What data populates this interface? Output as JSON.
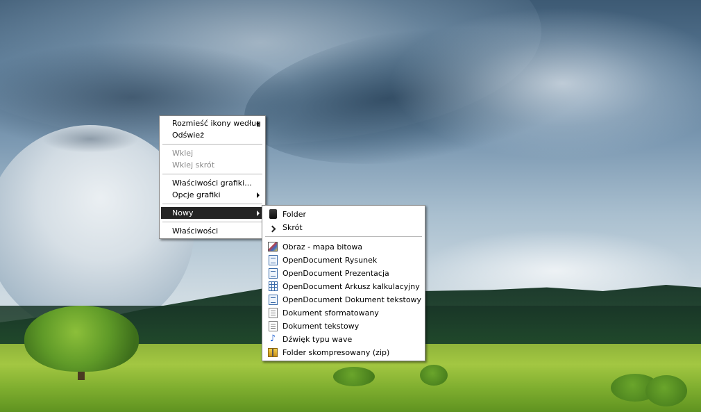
{
  "context_menu": {
    "items": [
      {
        "label": "Rozmieść ikony według",
        "has_submenu": true,
        "disabled": false
      },
      {
        "label": "Odśwież",
        "has_submenu": false,
        "disabled": false
      },
      {
        "label": "Wklej",
        "has_submenu": false,
        "disabled": true
      },
      {
        "label": "Wklej skrót",
        "has_submenu": false,
        "disabled": true
      },
      {
        "label": "Właściwości grafiki...",
        "has_submenu": false,
        "disabled": false
      },
      {
        "label": "Opcje grafiki",
        "has_submenu": true,
        "disabled": false
      },
      {
        "label": "Nowy",
        "has_submenu": true,
        "disabled": false,
        "highlighted": true
      },
      {
        "label": "Właściwości",
        "has_submenu": false,
        "disabled": false
      }
    ]
  },
  "new_submenu": {
    "items": [
      {
        "label": "Folder",
        "icon": "folder-icon"
      },
      {
        "label": "Skrót",
        "icon": "shortcut-icon"
      },
      {
        "label": "Obraz - mapa bitowa",
        "icon": "bitmap-image-icon"
      },
      {
        "label": "OpenDocument Rysunek",
        "icon": "opendocument-drawing-icon"
      },
      {
        "label": "OpenDocument Prezentacja",
        "icon": "opendocument-presentation-icon"
      },
      {
        "label": "OpenDocument Arkusz kalkulacyjny",
        "icon": "opendocument-spreadsheet-icon"
      },
      {
        "label": "OpenDocument Dokument tekstowy",
        "icon": "opendocument-text-icon"
      },
      {
        "label": "Dokument sformatowany",
        "icon": "rich-text-document-icon"
      },
      {
        "label": "Dokument tekstowy",
        "icon": "text-document-icon"
      },
      {
        "label": "Dźwięk typu wave",
        "icon": "wave-sound-icon"
      },
      {
        "label": "Folder skompresowany (zip)",
        "icon": "zip-folder-icon"
      }
    ]
  },
  "colors": {
    "menu_background": "#ffffff",
    "menu_border": "#868686",
    "highlight_background": "#242424",
    "highlight_text": "#ffffff",
    "disabled_text": "#8a8a8a"
  }
}
